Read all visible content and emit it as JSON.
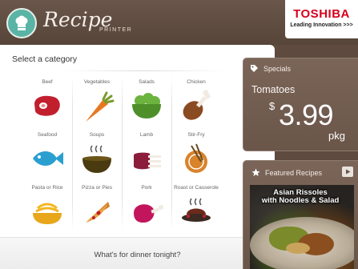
{
  "header": {
    "brand": "Recipe",
    "brand_sub": "PRINTER",
    "toshiba_name": "TOSHIBA",
    "toshiba_tagline": "Leading Innovation >>>"
  },
  "panel": {
    "title": "Select a category",
    "footer": "What's for dinner tonight?"
  },
  "categories": [
    {
      "label": "Beef",
      "icon": "steak-icon"
    },
    {
      "label": "Vegetables",
      "icon": "carrot-icon"
    },
    {
      "label": "Salads",
      "icon": "salad-bowl-icon"
    },
    {
      "label": "Chicken",
      "icon": "drumstick-icon"
    },
    {
      "label": "Seafood",
      "icon": "fish-icon"
    },
    {
      "label": "Soups",
      "icon": "soup-bowl-icon"
    },
    {
      "label": "Lamb",
      "icon": "lamb-rack-icon"
    },
    {
      "label": "Stir-Fry",
      "icon": "wok-icon"
    },
    {
      "label": "Pasta or Rice",
      "icon": "pasta-bowl-icon"
    },
    {
      "label": "Pizza or Pies",
      "icon": "pizza-slice-icon"
    },
    {
      "label": "Pork",
      "icon": "ham-icon"
    },
    {
      "label": "Roast or Casserole",
      "icon": "roast-platter-icon"
    }
  ],
  "specials": {
    "heading": "Specials",
    "item": "Tomatoes",
    "currency": "$",
    "price": "3.99",
    "unit": "pkg"
  },
  "featured": {
    "heading": "Featured Recipes",
    "title_line1": "Asian Rissoles",
    "title_line2": "with Noodles & Salad"
  },
  "colors": {
    "brand_teal": "#5ab4a6",
    "header_brown": "#5e4a3f",
    "toshiba_red": "#d6001c",
    "icon_red": "#c21f2e"
  }
}
